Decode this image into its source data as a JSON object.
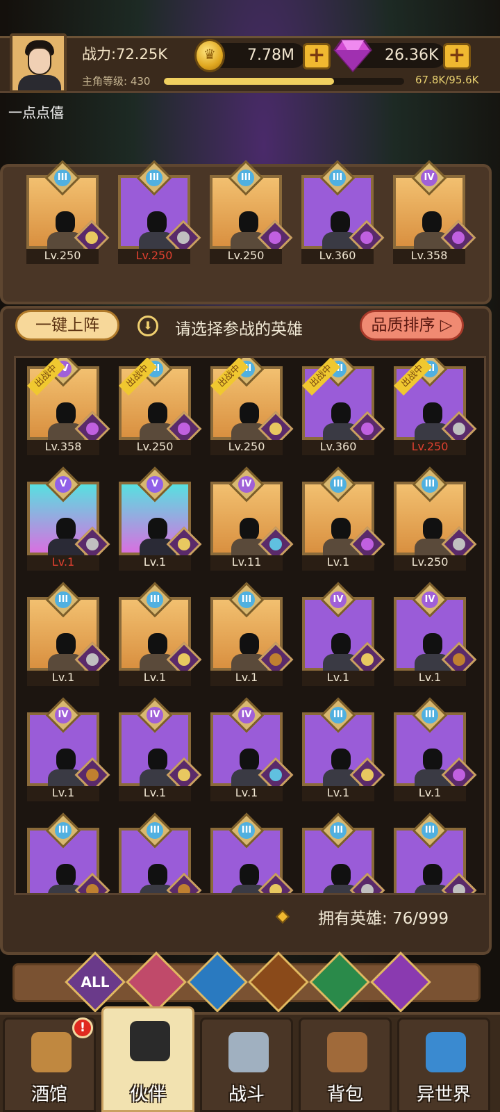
{
  "player": {
    "power": "战力:72.25K",
    "level_label": "主角等级: 430",
    "exp_text": "67.8K/95.6K",
    "exp_progress": 0.709,
    "username": "一点点僖"
  },
  "currency": {
    "gold": "7.78M",
    "gems": "26.36K",
    "plus": "+"
  },
  "team": [
    {
      "rank": "III",
      "level": "Lv.250",
      "quality": "gold",
      "faction": "elf",
      "red": false
    },
    {
      "rank": "III",
      "level": "Lv.250",
      "quality": "purple",
      "faction": "human",
      "red": true
    },
    {
      "rank": "III",
      "level": "Lv.250",
      "quality": "gold",
      "faction": "demon",
      "red": false
    },
    {
      "rank": "III",
      "level": "Lv.360",
      "quality": "purple",
      "faction": "demon",
      "red": false
    },
    {
      "rank": "IV",
      "level": "Lv.358",
      "quality": "gold",
      "faction": "demon",
      "red": false
    }
  ],
  "actions": {
    "one_key": "一键上阵",
    "hint": "请选择参战的英雄",
    "sort": "品质排序 ▷",
    "hint_icon": "⬇"
  },
  "deployed_label": "出战中",
  "heroes": [
    {
      "rank": "IV",
      "level": "Lv.358",
      "quality": "gold",
      "faction": "demon",
      "deployed": true,
      "red": false
    },
    {
      "rank": "III",
      "level": "Lv.250",
      "quality": "gold",
      "faction": "demon",
      "deployed": true,
      "red": false
    },
    {
      "rank": "III",
      "level": "Lv.250",
      "quality": "gold",
      "faction": "elf",
      "deployed": true,
      "red": false
    },
    {
      "rank": "III",
      "level": "Lv.360",
      "quality": "purple",
      "faction": "demon",
      "deployed": true,
      "red": false
    },
    {
      "rank": "III",
      "level": "Lv.250",
      "quality": "purple",
      "faction": "human",
      "deployed": true,
      "red": true
    },
    {
      "rank": "V",
      "level": "Lv.1",
      "quality": "teal",
      "faction": "human",
      "deployed": false,
      "red": true
    },
    {
      "rank": "V",
      "level": "Lv.1",
      "quality": "teal",
      "faction": "elf",
      "deployed": false,
      "red": false
    },
    {
      "rank": "IV",
      "level": "Lv.11",
      "quality": "gold",
      "faction": "fish",
      "deployed": false,
      "red": false
    },
    {
      "rank": "III",
      "level": "Lv.1",
      "quality": "gold",
      "faction": "demon",
      "deployed": false,
      "red": false
    },
    {
      "rank": "III",
      "level": "Lv.250",
      "quality": "gold",
      "faction": "human",
      "deployed": false,
      "red": false
    },
    {
      "rank": "III",
      "level": "Lv.1",
      "quality": "gold",
      "faction": "human",
      "deployed": false,
      "red": false
    },
    {
      "rank": "III",
      "level": "Lv.1",
      "quality": "gold",
      "faction": "elf",
      "deployed": false,
      "red": false
    },
    {
      "rank": "III",
      "level": "Lv.1",
      "quality": "gold",
      "faction": "lion",
      "deployed": false,
      "red": false
    },
    {
      "rank": "IV",
      "level": "Lv.1",
      "quality": "purple",
      "faction": "elf",
      "deployed": false,
      "red": false
    },
    {
      "rank": "IV",
      "level": "Lv.1",
      "quality": "purple",
      "faction": "lion",
      "deployed": false,
      "red": false
    },
    {
      "rank": "IV",
      "level": "Lv.1",
      "quality": "purple",
      "faction": "lion",
      "deployed": false,
      "red": false
    },
    {
      "rank": "IV",
      "level": "Lv.1",
      "quality": "purple",
      "faction": "elf",
      "deployed": false,
      "red": false
    },
    {
      "rank": "IV",
      "level": "Lv.1",
      "quality": "purple",
      "faction": "fish",
      "deployed": false,
      "red": false
    },
    {
      "rank": "III",
      "level": "Lv.1",
      "quality": "purple",
      "faction": "elf",
      "deployed": false,
      "red": false
    },
    {
      "rank": "III",
      "level": "Lv.1",
      "quality": "purple",
      "faction": "demon",
      "deployed": false,
      "red": false
    },
    {
      "rank": "III",
      "level": "",
      "quality": "purple",
      "faction": "lion",
      "deployed": false,
      "red": false
    },
    {
      "rank": "III",
      "level": "",
      "quality": "purple",
      "faction": "lion",
      "deployed": false,
      "red": false
    },
    {
      "rank": "III",
      "level": "",
      "quality": "purple",
      "faction": "elf",
      "deployed": false,
      "red": false
    },
    {
      "rank": "III",
      "level": "",
      "quality": "purple",
      "faction": "human",
      "deployed": false,
      "red": false
    },
    {
      "rank": "III",
      "level": "",
      "quality": "purple",
      "faction": "human",
      "deployed": false,
      "red": false
    }
  ],
  "hero_count": "拥有英雄: 76/999",
  "filters": [
    {
      "label": "ALL",
      "icon": "all-icon",
      "color": "#6a3a8a"
    },
    {
      "label": "",
      "icon": "human-faction-icon",
      "color": "#c04a6a"
    },
    {
      "label": "",
      "icon": "fish-faction-icon",
      "color": "#2a7ac0"
    },
    {
      "label": "",
      "icon": "lion-faction-icon",
      "color": "#8a4a1a"
    },
    {
      "label": "",
      "icon": "elf-faction-icon",
      "color": "#2a8a4a"
    },
    {
      "label": "",
      "icon": "demon-faction-icon",
      "color": "#8a3ab0"
    }
  ],
  "tabs": [
    {
      "label": "酒馆",
      "icon": "tavern-icon",
      "color": "#c08840"
    },
    {
      "label": "伙伴",
      "icon": "partner-icon",
      "color": "#2a2a2a"
    },
    {
      "label": "战斗",
      "icon": "battle-icon",
      "color": "#a0b0c0"
    },
    {
      "label": "背包",
      "icon": "backpack-icon",
      "color": "#a06a3a"
    },
    {
      "label": "异世界",
      "icon": "portal-icon",
      "color": "#3a8ad0"
    }
  ],
  "alert": "!",
  "colors": {
    "gold_frame": "#d99040",
    "purple_frame": "#9a5cd8",
    "teal_frame": "#58e0e0",
    "red_level": "#e04030"
  }
}
